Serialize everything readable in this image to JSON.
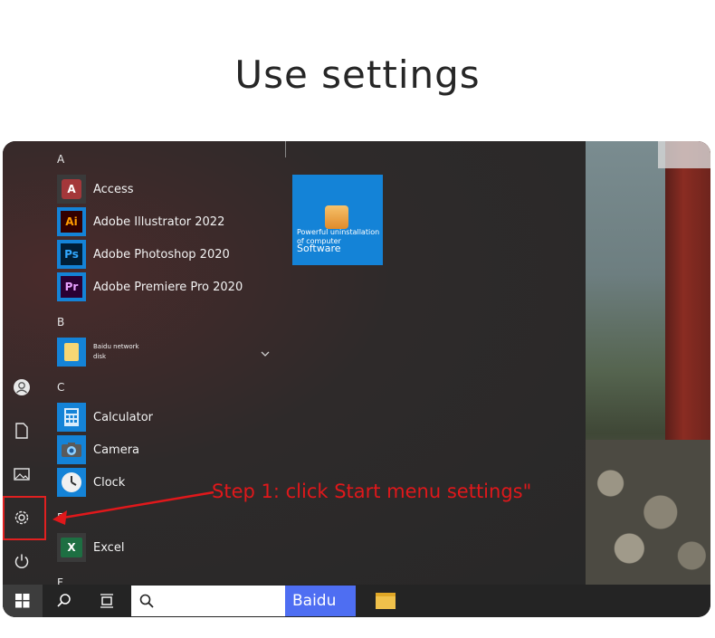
{
  "heading": "Use settings",
  "start_menu": {
    "sections": [
      {
        "letter": "A",
        "apps": [
          {
            "label": "Access",
            "icon": "access-icon",
            "color": "#a4373a"
          },
          {
            "label": "Adobe Illustrator 2022",
            "icon": "illustrator-icon",
            "color": "#ff9a00"
          },
          {
            "label": "Adobe Photoshop 2020",
            "icon": "photoshop-icon",
            "color": "#31a8ff"
          },
          {
            "label": "Adobe Premiere Pro 2020",
            "icon": "premiere-icon",
            "color": "#9999ff"
          }
        ]
      },
      {
        "letter": "B",
        "apps": [
          {
            "label": "Baidu network disk",
            "icon": "folder-icon",
            "color": "#f7d774"
          }
        ]
      },
      {
        "letter": "C",
        "apps": [
          {
            "label": "Calculator",
            "icon": "calculator-icon",
            "color": "#1483d7"
          },
          {
            "label": "Camera",
            "icon": "camera-icon",
            "color": "#1483d7"
          },
          {
            "label": "Clock",
            "icon": "clock-icon",
            "color": "#1483d7"
          }
        ]
      },
      {
        "letter": "E",
        "apps": [
          {
            "label": "Excel",
            "icon": "excel-icon",
            "color": "#1d6f42"
          }
        ]
      },
      {
        "letter": "F",
        "apps": []
      }
    ],
    "tile": {
      "line1": "Powerful uninstallation of computer",
      "line2": "Software"
    }
  },
  "rail": {
    "icons": [
      "user-icon",
      "document-icon",
      "pictures-icon",
      "settings-icon",
      "power-icon"
    ]
  },
  "taskbar": {
    "search_button": "Baidu",
    "search_placeholder": ""
  },
  "annotation": {
    "callout": "Step 1: click Start menu settings\"",
    "color": "#e0181b"
  }
}
